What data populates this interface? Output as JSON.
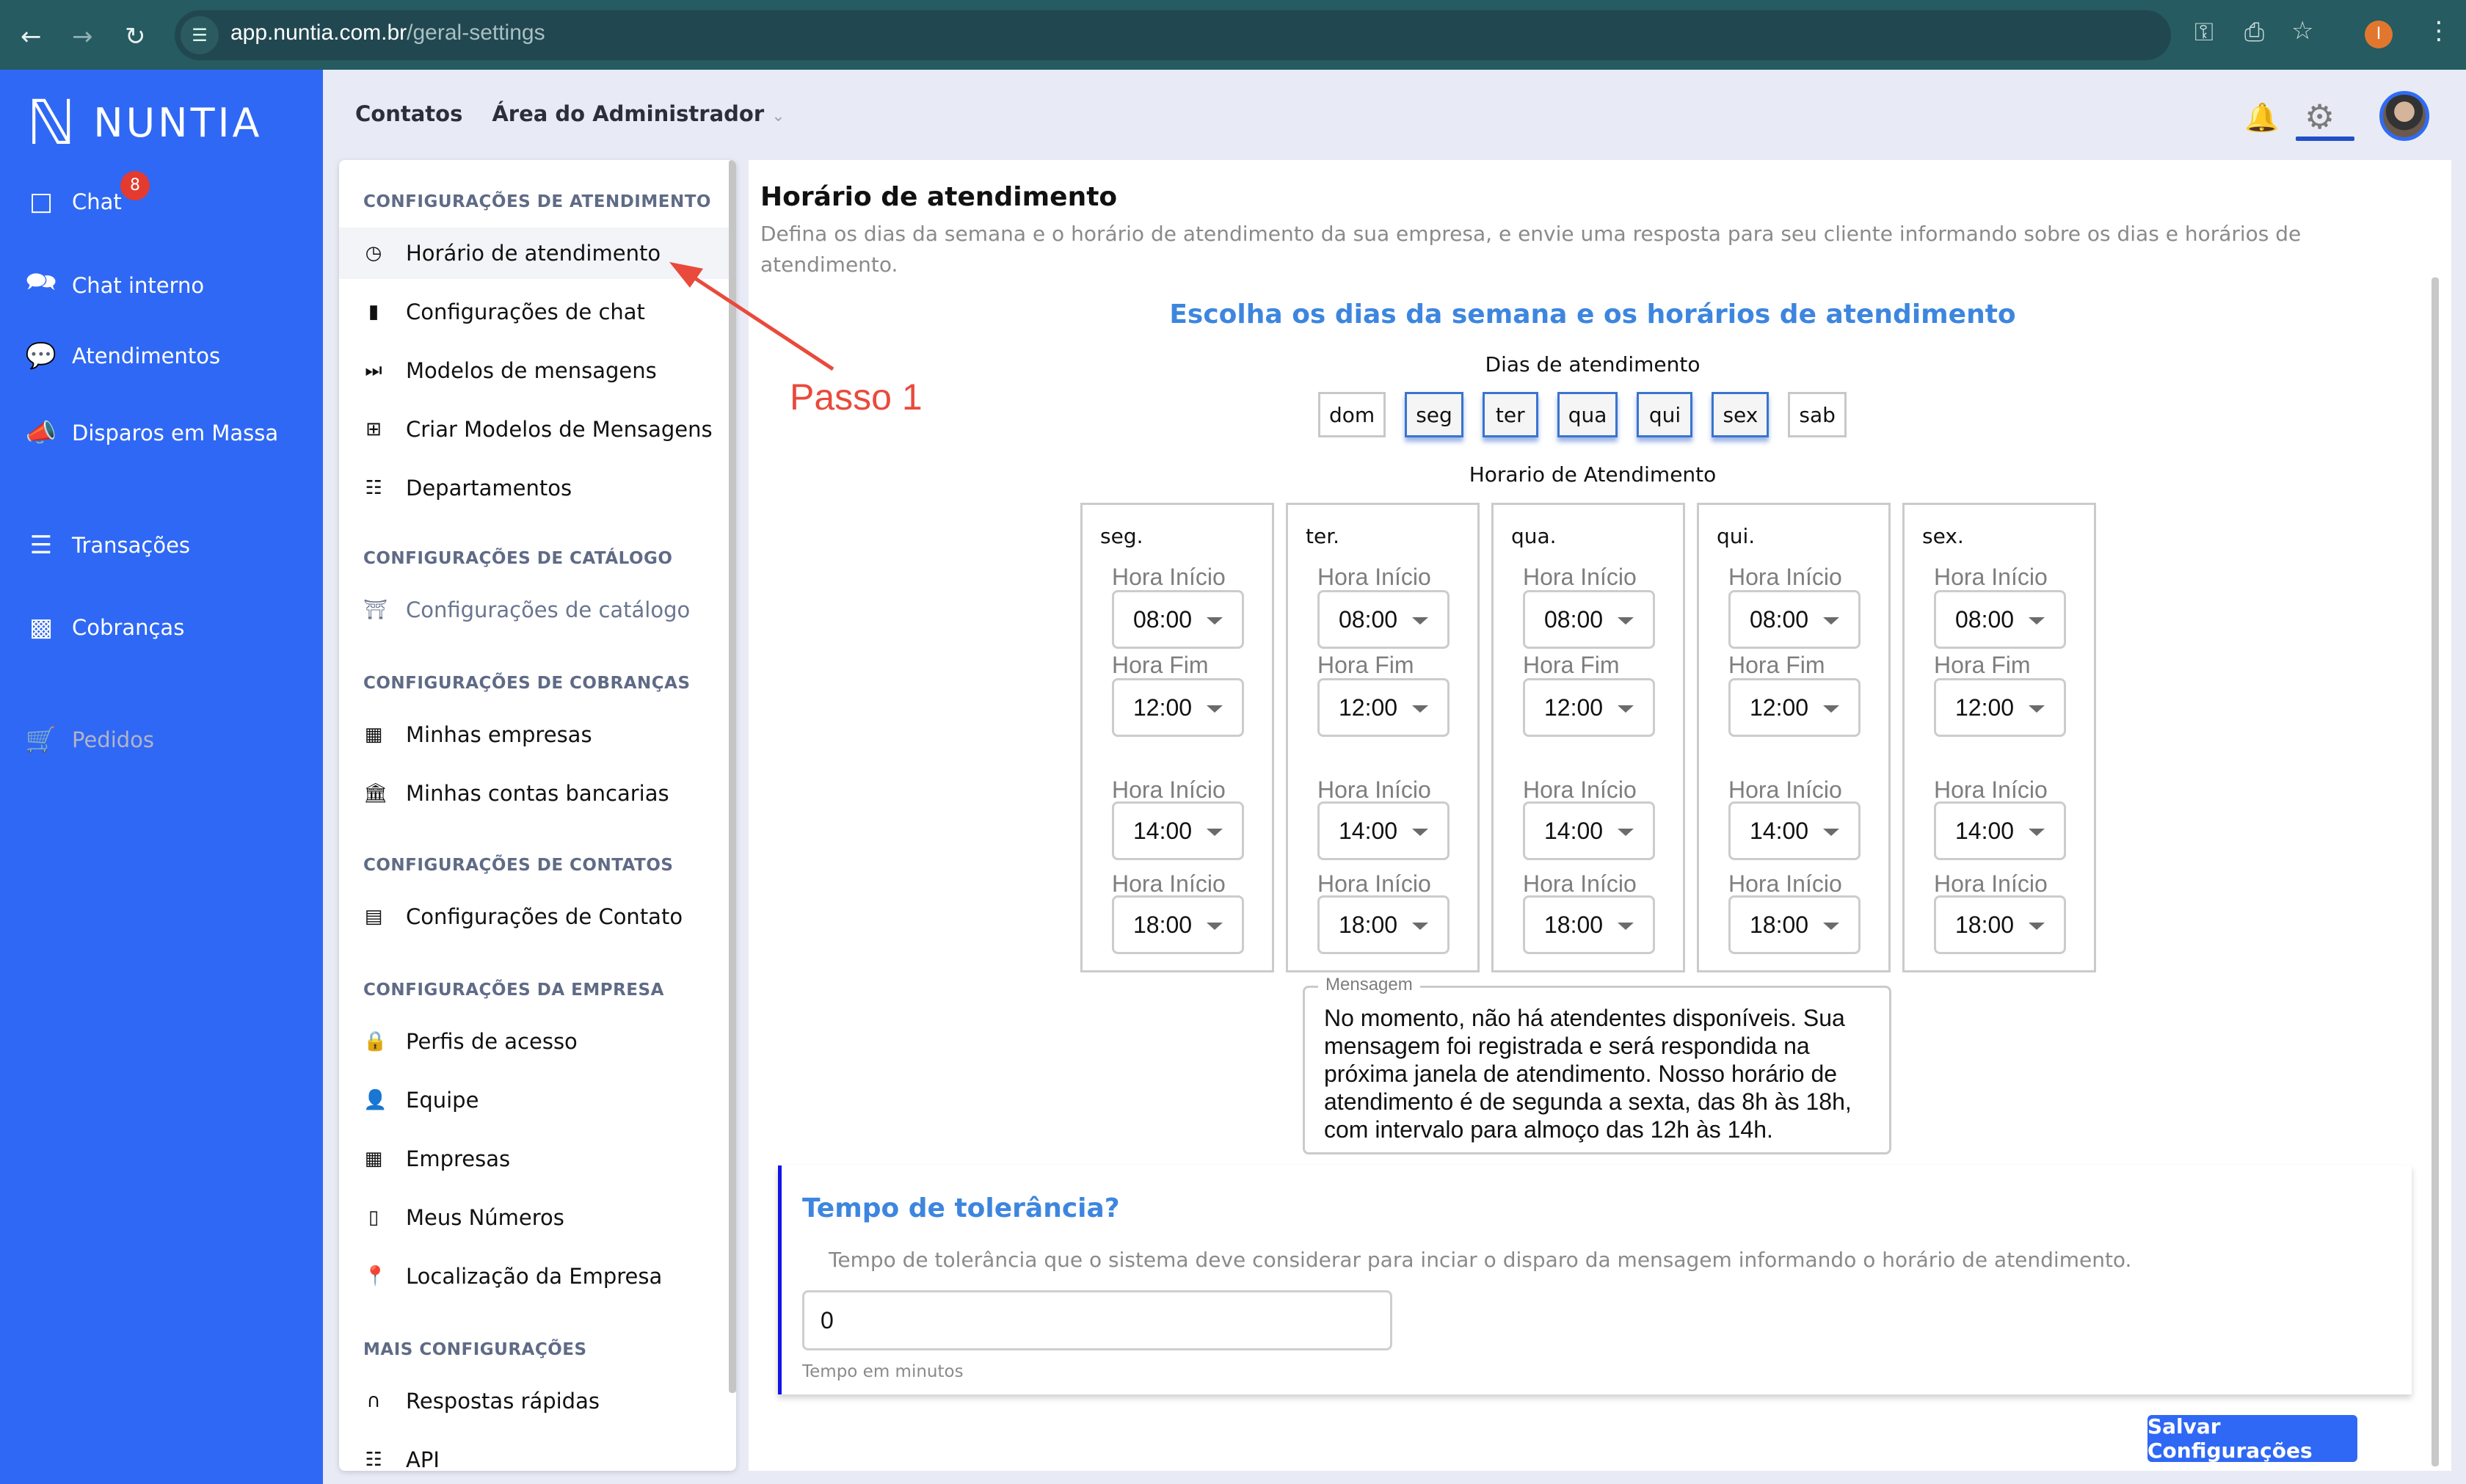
{
  "browser": {
    "url_host": "app.nuntia.com.br",
    "url_path": "/geral-settings",
    "back_icon": "arrow-left-icon",
    "forward_icon": "arrow-right-icon",
    "reload_icon": "reload-icon",
    "profile_initial": "I"
  },
  "sidebar": {
    "logo_text": "NUNTIA",
    "items": [
      {
        "label": "Chat",
        "icon": "chat-icon",
        "badge": "8"
      },
      {
        "label": "Chat interno",
        "icon": "chat-bubbles-icon"
      },
      {
        "label": "Atendimentos",
        "icon": "chat-dots-icon"
      },
      {
        "label": "Disparos em Massa",
        "icon": "megaphone-icon"
      },
      {
        "label": "Transações",
        "icon": "list-icon"
      },
      {
        "label": "Cobranças",
        "icon": "money-bill-icon"
      },
      {
        "label": "Pedidos",
        "icon": "cart-icon",
        "disabled": true
      }
    ]
  },
  "topnav": {
    "contatos": "Contatos",
    "admin_area": "Área do Administrador"
  },
  "settings_menu": {
    "sections": [
      {
        "header": "CONFIGURAÇÕES DE ATENDIMENTO",
        "items": [
          "Horário de atendimento",
          "Configurações de chat",
          "Modelos de mensagens",
          "Criar Modelos de Mensagens",
          "Departamentos"
        ]
      },
      {
        "header": "CONFIGURAÇÕES DE CATÁLOGO",
        "items": [
          "Configurações de catálogo"
        ]
      },
      {
        "header": "CONFIGURAÇÕES DE COBRANÇAS",
        "items": [
          "Minhas empresas",
          "Minhas contas bancarias"
        ]
      },
      {
        "header": "CONFIGURAÇÕES DE CONTATOS",
        "items": [
          "Configurações de Contato"
        ]
      },
      {
        "header": "CONFIGURAÇÕES DA EMPRESA",
        "items": [
          "Perfis de acesso",
          "Equipe",
          "Empresas",
          "Meus Números",
          "Localização da Empresa"
        ]
      },
      {
        "header": "MAIS CONFIGURAÇÕES",
        "items": [
          "Respostas rápidas",
          "API"
        ]
      }
    ],
    "active_item": "Horário de atendimento"
  },
  "content": {
    "title": "Horário de atendimento",
    "description": "Defina os dias da semana e o horário de atendimento da sua empresa, e envie uma resposta para seu cliente informando sobre os dias e horários de atendimento.",
    "choose_heading": "Escolha os dias da semana e os horários de atendimento",
    "days_label": "Dias de atendimento",
    "days": [
      {
        "label": "dom",
        "selected": false
      },
      {
        "label": "seg",
        "selected": true
      },
      {
        "label": "ter",
        "selected": true
      },
      {
        "label": "qua",
        "selected": true
      },
      {
        "label": "qui",
        "selected": true
      },
      {
        "label": "sex",
        "selected": true
      },
      {
        "label": "sab",
        "selected": false
      }
    ],
    "schedule_label": "Horario de Atendimento",
    "schedule": [
      {
        "day": "seg.",
        "slots": [
          {
            "label": "Hora Início",
            "value": "08:00"
          },
          {
            "label": "Hora Fim",
            "value": "12:00"
          },
          {
            "label": "Hora Início",
            "value": "14:00"
          },
          {
            "label": "Hora Início",
            "value": "18:00"
          }
        ]
      },
      {
        "day": "ter.",
        "slots": [
          {
            "label": "Hora Início",
            "value": "08:00"
          },
          {
            "label": "Hora Fim",
            "value": "12:00"
          },
          {
            "label": "Hora Início",
            "value": "14:00"
          },
          {
            "label": "Hora Início",
            "value": "18:00"
          }
        ]
      },
      {
        "day": "qua.",
        "slots": [
          {
            "label": "Hora Início",
            "value": "08:00"
          },
          {
            "label": "Hora Fim",
            "value": "12:00"
          },
          {
            "label": "Hora Início",
            "value": "14:00"
          },
          {
            "label": "Hora Início",
            "value": "18:00"
          }
        ]
      },
      {
        "day": "qui.",
        "slots": [
          {
            "label": "Hora Início",
            "value": "08:00"
          },
          {
            "label": "Hora Fim",
            "value": "12:00"
          },
          {
            "label": "Hora Início",
            "value": "14:00"
          },
          {
            "label": "Hora Início",
            "value": "18:00"
          }
        ]
      },
      {
        "day": "sex.",
        "slots": [
          {
            "label": "Hora Início",
            "value": "08:00"
          },
          {
            "label": "Hora Fim",
            "value": "12:00"
          },
          {
            "label": "Hora Início",
            "value": "14:00"
          },
          {
            "label": "Hora Início",
            "value": "18:00"
          }
        ]
      }
    ],
    "message_legend": "Mensagem",
    "message_text": "No momento, não há atendentes disponíveis. Sua mensagem foi registrada e será respondida na próxima janela de atendimento. Nosso horário de atendimento é de segunda a sexta, das 8h às 18h, com intervalo para almoço das 12h às 14h.",
    "tolerance": {
      "title": "Tempo de tolerância?",
      "description": "Tempo de tolerância que o sistema deve considerar para inciar o disparo da mensagem informando o horário de atendimento.",
      "value": "0",
      "hint": "Tempo em minutos"
    },
    "save_label": "Salvar Configurações"
  },
  "annotation": {
    "text": "Passo 1",
    "color": "#e94a3b"
  },
  "colors": {
    "brand": "#2f68f5",
    "heading_blue": "#3d86df",
    "badge": "#e53a2f"
  }
}
